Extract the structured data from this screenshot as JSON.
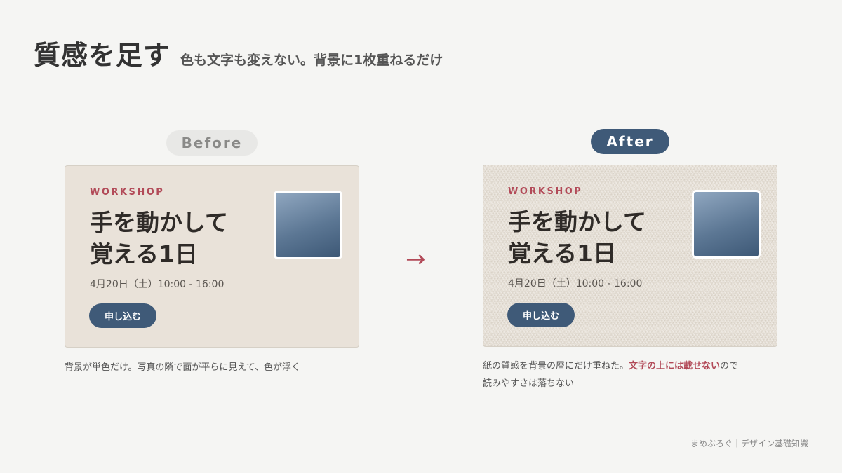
{
  "header": {
    "title": "質感を足す",
    "subtitle": "色も文字も変えない。背景に1枚重ねるだけ"
  },
  "before": {
    "pill_label": "Before",
    "card": {
      "eyebrow": "WORKSHOP",
      "headline": "手を動かして\n覚える1日",
      "date": "4月20日（土）10:00 - 16:00",
      "button_label": "申し込む"
    },
    "caption": "背景が単色だけ。写真の隣で面が平らに見えて、色が浮く"
  },
  "arrow": "→",
  "after": {
    "pill_label": "After",
    "card": {
      "eyebrow": "WORKSHOP",
      "headline": "手を動かして\n覚える1日",
      "date": "4月20日（土）10:00 - 16:00",
      "button_label": "申し込む"
    },
    "caption_part1": "紙の質感を背景の層にだけ重ねた。",
    "caption_highlight": "文字の上には載せない",
    "caption_part2": "ので",
    "caption_line2": "読みやすさは落ちない"
  },
  "footer": "まめぶろぐ｜デザイン基礎知識",
  "colors": {
    "accent": "#b24a58",
    "brand_navy": "#3f5a78",
    "card_plain": "#e9e2d9",
    "card_texture": "#e7e1d8",
    "background": "#f5f5f3"
  }
}
